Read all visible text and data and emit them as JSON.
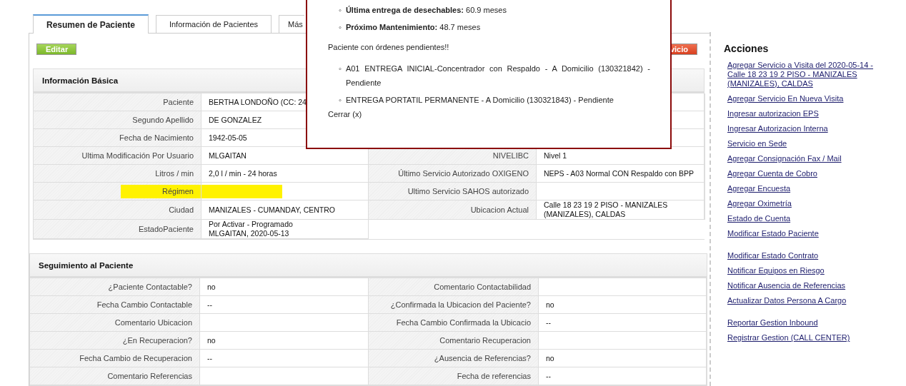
{
  "tabs": [
    {
      "label": "Resumen de Paciente",
      "selected": true
    },
    {
      "label": "Información de Pacientes",
      "selected": false
    },
    {
      "label": "Más",
      "selected": false
    }
  ],
  "buttons": [
    {
      "label": "Editar",
      "kind": "edit"
    },
    {
      "label": "vicio",
      "kind": "danger"
    }
  ],
  "basic_info": {
    "title": "Información Básica",
    "rows": [
      {
        "label": "Paciente",
        "value": "BERTHA LONDOÑO (CC: 24",
        "highlighted": false,
        "label_2": "",
        "value_2": ""
      },
      {
        "label": "Segundo Apellido",
        "value": "DE GONZALEZ",
        "highlighted": false,
        "label_2": "",
        "value_2": ""
      },
      {
        "label": "Fecha de Nacimiento",
        "value": "1942-05-05",
        "highlighted": false,
        "label_2": "",
        "value_2": ""
      },
      {
        "label": "Ultima Modificación Por Usuario",
        "value": "MLGAITAN",
        "highlighted": false,
        "label_2": "NIVELIBC",
        "value_2": "Nivel 1"
      },
      {
        "label": "Litros / min",
        "value": "2,0 l / min - 24 horas",
        "highlighted": false,
        "label_2": "Último Servicio Autorizado OXIGENO",
        "value_2": "NEPS - A03 Normal CON Respaldo con BPP"
      },
      {
        "label": "Régimen",
        "value": "",
        "highlighted": true,
        "label_2": "Ultimo Servicio SAHOS autorizado",
        "value_2": ""
      },
      {
        "label": "Ciudad",
        "value": "MANIZALES - CUMANDAY, CENTRO",
        "highlighted": false,
        "label_2": "Ubicacion Actual",
        "value_2": "Calle 18 23 19 2 PISO - MANIZALES (MANIZALES), CALDAS"
      },
      {
        "label": "EstadoPaciente",
        "value": "Por Activar - Programado\nMLGAITAN, 2020-05-13",
        "highlighted": false
      }
    ]
  },
  "follow_up": {
    "title": "Seguimiento al Paciente",
    "rows": [
      {
        "label": "¿Paciente Contactable?",
        "value": "no",
        "label_2": "Comentario Contactabilidad",
        "value_2": ""
      },
      {
        "label": "Fecha Cambio Contactable",
        "value": "--",
        "label_2": "¿Confirmada la Ubicacion del Paciente?",
        "value_2": "no"
      },
      {
        "label": "Comentario Ubicacion",
        "value": "",
        "label_2": "Fecha Cambio Confirmada la Ubicacio",
        "value_2": "--"
      },
      {
        "label": "¿En Recuperacion?",
        "value": "no",
        "label_2": "Comentario Recuperacion",
        "value_2": ""
      },
      {
        "label": "Fecha Cambio de Recuperacion",
        "value": "--",
        "label_2": "¿Ausencia de Referencias?",
        "value_2": "no"
      },
      {
        "label": "Comentario Referencias",
        "value": "",
        "label_2": "Fecha de referencias",
        "value_2": "--"
      }
    ]
  },
  "actions": {
    "title": "Acciones",
    "groups": [
      [
        "Agregar Servicio a Visita del 2020-05-14 - Calle 18 23 19 2 PISO - MANIZALES (MANIZALES), CALDAS",
        "Agregar Servicio En Nueva Visita",
        "Ingresar autorizacion EPS",
        "Ingresar Autorizacion Interna",
        "Servicio en Sede",
        "Agregar Consignación Fax / Mail",
        "Agregar Cuenta de Cobro",
        "Agregar Encuesta",
        "Agregar Oximetría",
        "Estado de Cuenta",
        "Modificar Estado Paciente"
      ],
      [
        "Modificar Estado Contrato",
        "Notificar Equipos en Riesgo",
        "Notificar Ausencia de Referencias",
        "Actualizar Datos Persona A Cargo"
      ],
      [
        "Reportar Gestion Inbound",
        "Registrar Gestion (CALL CENTER)"
      ]
    ]
  },
  "popup": {
    "bullet": "◦",
    "facts": [
      "**Última entrega de desechables:** 60.9 meses",
      "**Próximo Mantenimiento:** 48.7 meses"
    ],
    "notice": "Paciente con órdenes pendientes!!",
    "orders": [
      "A01 ENTREGA INICIAL-Concentrador con Respaldo - A Domicilio (130321842) - Pendiente",
      "ENTREGA PORTATIL PERMANENTE - A Domicilio (130321843) - Pendiente"
    ],
    "close": "Cerrar (x)"
  }
}
